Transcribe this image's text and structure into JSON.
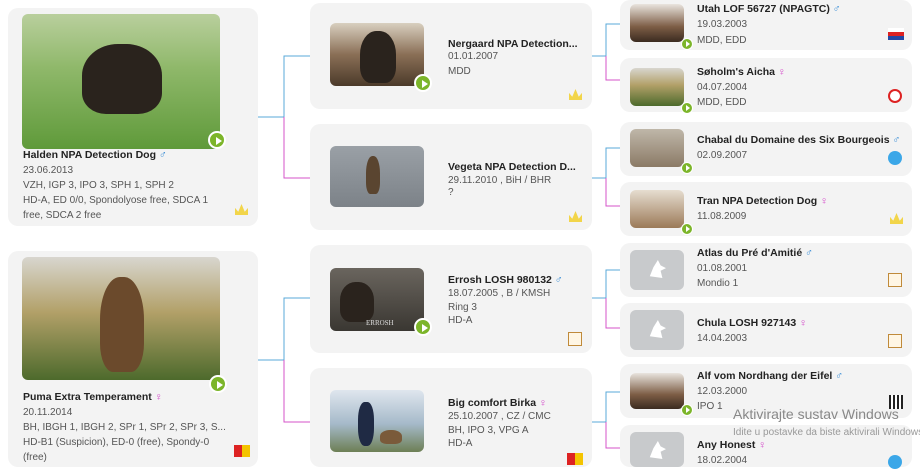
{
  "gen1": [
    {
      "name": "Halden NPA Detection Dog",
      "sex": "♂",
      "date": "23.06.2013",
      "info1": "VZH, IGP 3, IPO 3, SPH 1, SPH 2",
      "info2": "HD-A, ED 0/0, Spondolyose free, SDCA 1",
      "info3": "free, SDCA 2 free"
    },
    {
      "name": "Puma Extra Temperament",
      "sex": "♀",
      "date": "20.11.2014",
      "info1": "BH, IBGH 1, IBGH 2, SPr 1, SPr 2, SPr 3, S...",
      "info2": "HD-B1 (Suspicion), ED-0 (free), Spondy-0",
      "info3": "(free)"
    }
  ],
  "gen2": [
    {
      "name": "Nergaard NPA Detection...",
      "sex": "",
      "date": "01.01.2007",
      "info1": "MDD",
      "info2": ""
    },
    {
      "name": "Vegeta NPA Detection D...",
      "sex": "",
      "date": "29.11.2010 , BiH / BHR",
      "info1": "?",
      "info2": ""
    },
    {
      "name": "Errosh LOSH 980132",
      "sex": "♂",
      "date": "18.07.2005 , B / KMSH",
      "info1": "Ring 3",
      "info2": "HD-A",
      "photo_caption": "ERROSH"
    },
    {
      "name": "Big comfort Birka",
      "sex": "♀",
      "date": "25.10.2007 , CZ / CMC",
      "info1": "BH, IPO 3, VPG A",
      "info2": "HD-A"
    }
  ],
  "gen3": [
    {
      "name": "Utah LOF 56727 (NPAGTC)",
      "sex": "♂",
      "date": "19.03.2003",
      "info": "MDD, EDD"
    },
    {
      "name": "Søholm's Aicha",
      "sex": "♀",
      "date": "04.07.2004",
      "info": "MDD, EDD"
    },
    {
      "name": "Chabal du Domaine des Six Bourgeois",
      "sex": "♂",
      "date": "02.09.2007",
      "info": ""
    },
    {
      "name": "Tran NPA Detection Dog",
      "sex": "♀",
      "date": "11.08.2009",
      "info": ""
    },
    {
      "name": "Atlas du Pré d'Amitié",
      "sex": "♂",
      "date": "01.08.2001",
      "info": "Mondio 1"
    },
    {
      "name": "Chula LOSH 927143",
      "sex": "♀",
      "date": "14.04.2003",
      "info": ""
    },
    {
      "name": "Alf vom Nordhang der Eifel",
      "sex": "♂",
      "date": "12.03.2000",
      "info": "IPO 1"
    },
    {
      "name": "Any Honest",
      "sex": "♀",
      "date": "18.02.2004",
      "info": ""
    }
  ],
  "watermark": {
    "line1": "Aktivirajte sustav Windows",
    "line2": "Idite u postavke da biste aktivirali Windows."
  },
  "colors": {
    "male": "#3b8ed6",
    "female": "#d23fc7",
    "play": "#7cb52a",
    "line_blue": "#5aa9d8",
    "line_pink": "#d453c9"
  },
  "icons": [
    "play-icon",
    "crown-icon",
    "flag-icon",
    "no-entry-icon",
    "document-icon",
    "globe-badge-icon",
    "qr-icon",
    "placeholder-dog-icon"
  ]
}
